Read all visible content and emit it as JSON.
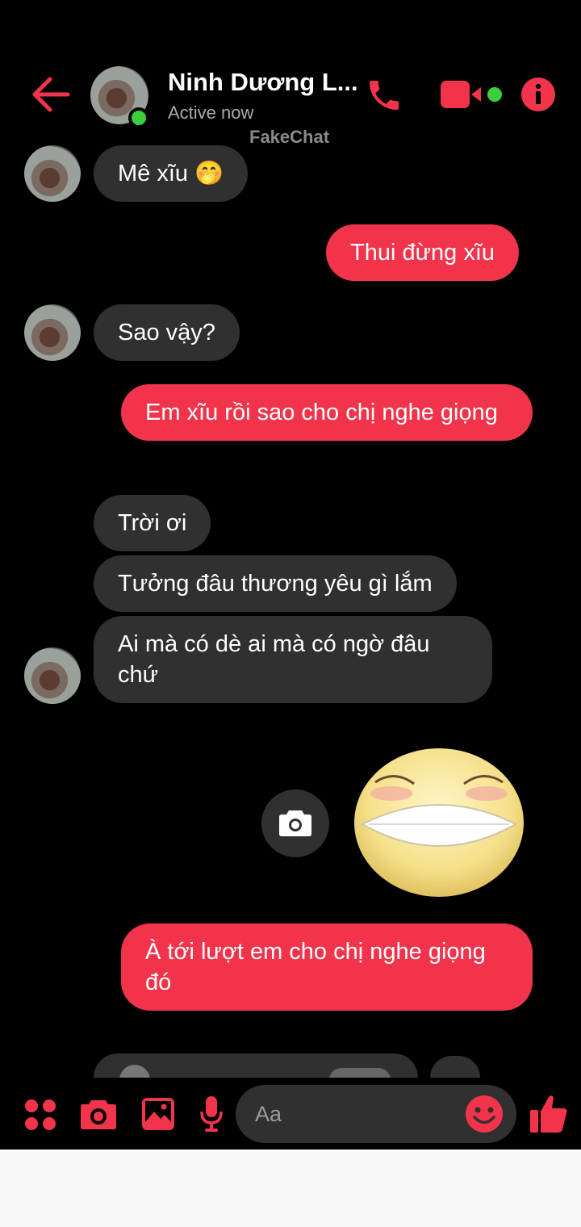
{
  "header": {
    "contact_name": "Ninh Dương L...",
    "status": "Active now",
    "watermark": "FakeChat"
  },
  "messages": [
    {
      "side": "in",
      "text": "Mê xĩu 🤭"
    },
    {
      "side": "out",
      "text": "Thui đừng xĩu"
    },
    {
      "side": "in",
      "text": "Sao vậy?"
    },
    {
      "side": "out",
      "text": "Em xĩu rồi sao cho chị nghe giọng"
    },
    {
      "side": "in",
      "text": "Trời ơi"
    },
    {
      "side": "in",
      "text": "Tưởng đâu thương yêu gì lắm"
    },
    {
      "side": "in",
      "text": "Ai mà có dè ai mà có ngờ đâu chứ"
    },
    {
      "side": "out",
      "type": "sticker",
      "sticker": "grinning-face-sticker"
    },
    {
      "side": "out",
      "text": "À tới lượt em cho chị nghe giọng đó"
    },
    {
      "side": "in",
      "type": "voice-message"
    }
  ],
  "composer": {
    "placeholder": "Aa"
  },
  "colors": {
    "accent": "#f1344b",
    "incoming_bubble": "#303030",
    "background": "#000000",
    "online": "#3ccf3c"
  }
}
